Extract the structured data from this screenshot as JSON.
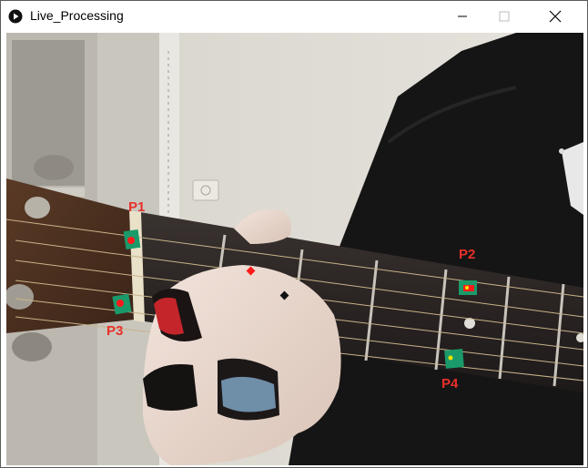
{
  "window": {
    "title": "Live_Processing",
    "controls": {
      "minimize": "minimize-icon",
      "maximize": "maximize-icon",
      "close": "close-icon"
    }
  },
  "markers": {
    "label_color": "#e8302a",
    "marker_color": "#ff1a1a",
    "tracking_color": "#1a9a6a",
    "points": [
      {
        "label": "P1"
      },
      {
        "label": "P2"
      },
      {
        "label": "P3"
      },
      {
        "label": "P4"
      }
    ]
  }
}
